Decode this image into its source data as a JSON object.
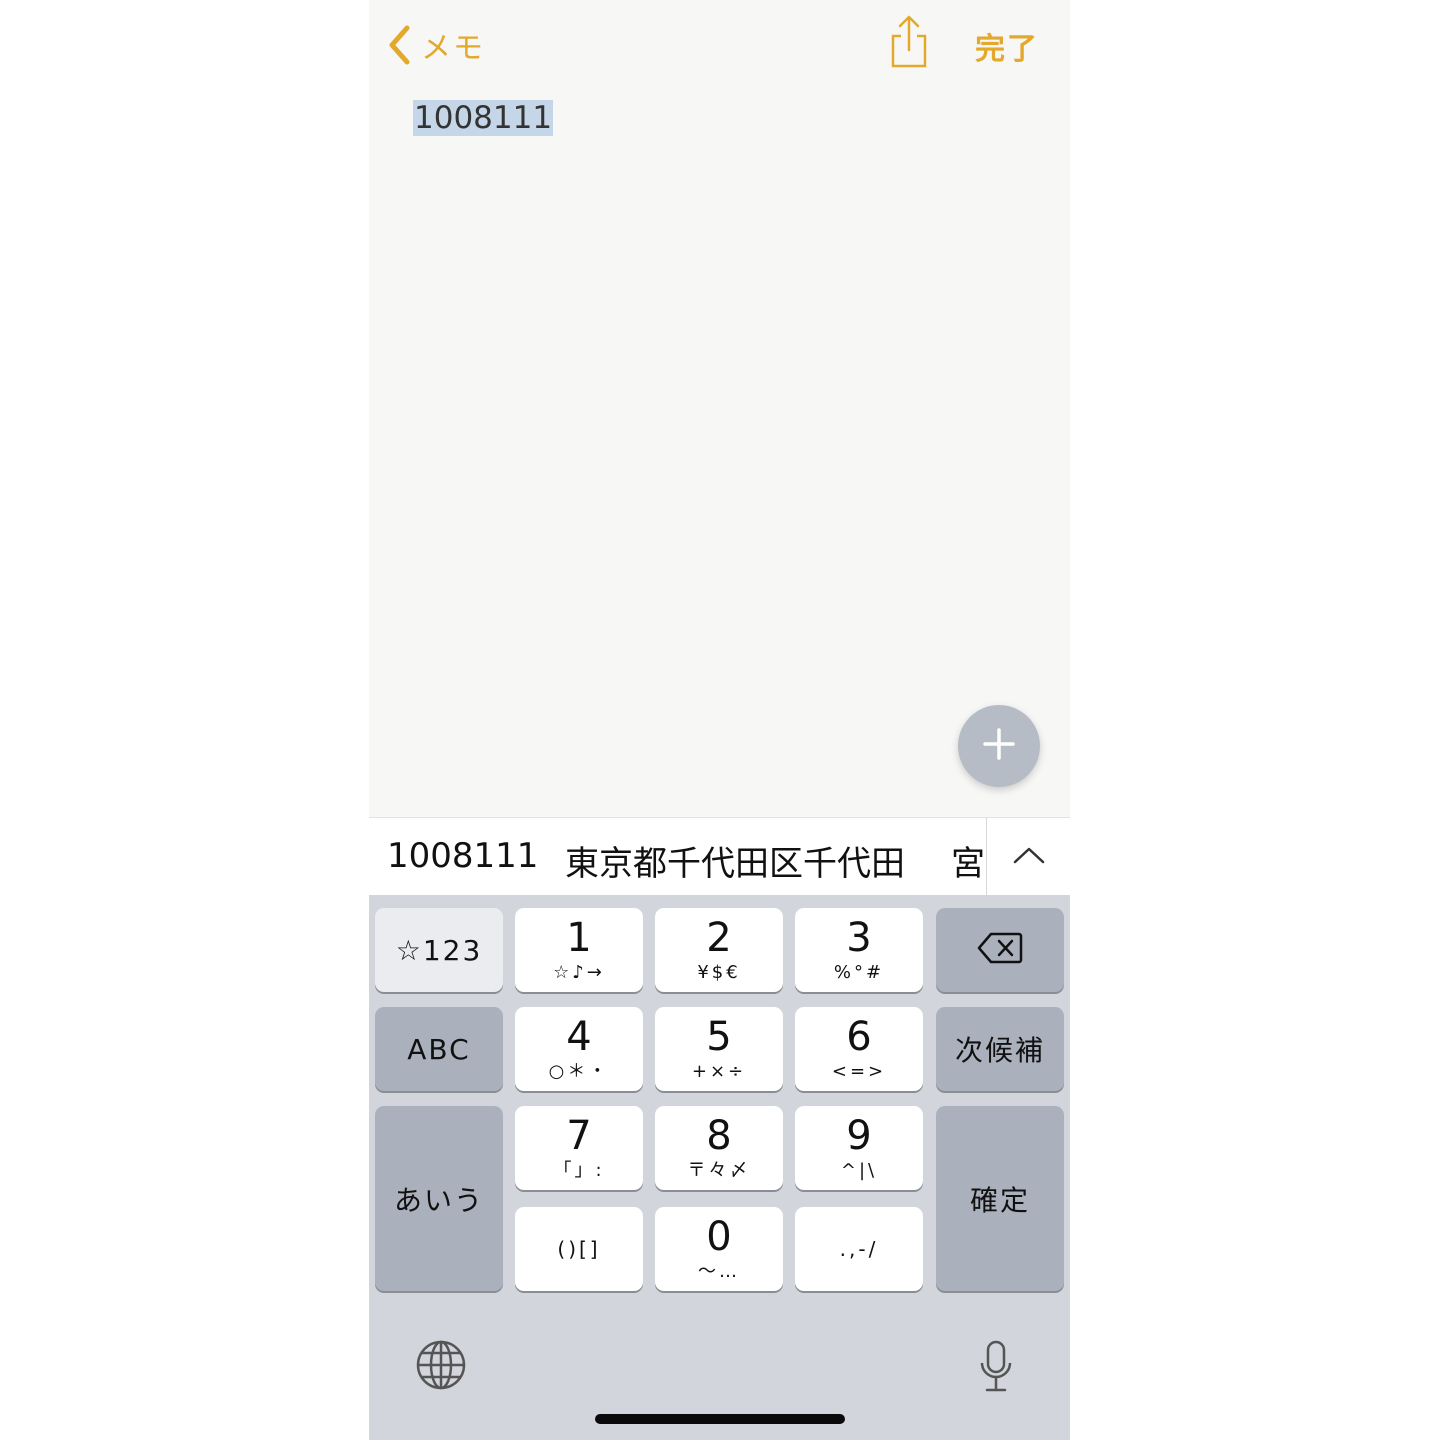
{
  "header": {
    "back_label": "メモ",
    "done_label": "完了",
    "accent_color": "#e3a92c",
    "back_icon": "chevron-left-icon",
    "share_icon": "share-icon"
  },
  "note": {
    "selected_text": "1008111"
  },
  "fab": {
    "icon": "plus-icon"
  },
  "suggestions": {
    "items": [
      "1008111",
      "東京都千代田区千代田",
      "宮"
    ],
    "expand_icon": "chevron-up-icon"
  },
  "keyboard": {
    "left_keys": [
      "☆123",
      "ABC",
      "あいう"
    ],
    "keys": [
      {
        "main": "1",
        "sub": "☆♪→"
      },
      {
        "main": "2",
        "sub": "¥$€"
      },
      {
        "main": "3",
        "sub": "%°#"
      },
      {
        "main": "4",
        "sub": "○＊・"
      },
      {
        "main": "5",
        "sub": "+×÷"
      },
      {
        "main": "6",
        "sub": "<=>"
      },
      {
        "main": "7",
        "sub": "「」:"
      },
      {
        "main": "8",
        "sub": "〒々〆"
      },
      {
        "main": "9",
        "sub": "^|\\"
      },
      {
        "main": "",
        "sub": "()[]"
      },
      {
        "main": "0",
        "sub": "〜…"
      },
      {
        "main": "",
        "sub": ".,-/"
      }
    ],
    "right_keys": [
      "次候補",
      "確定"
    ],
    "delete_icon": "backspace-icon",
    "globe_icon": "globe-icon",
    "mic_icon": "microphone-icon"
  }
}
